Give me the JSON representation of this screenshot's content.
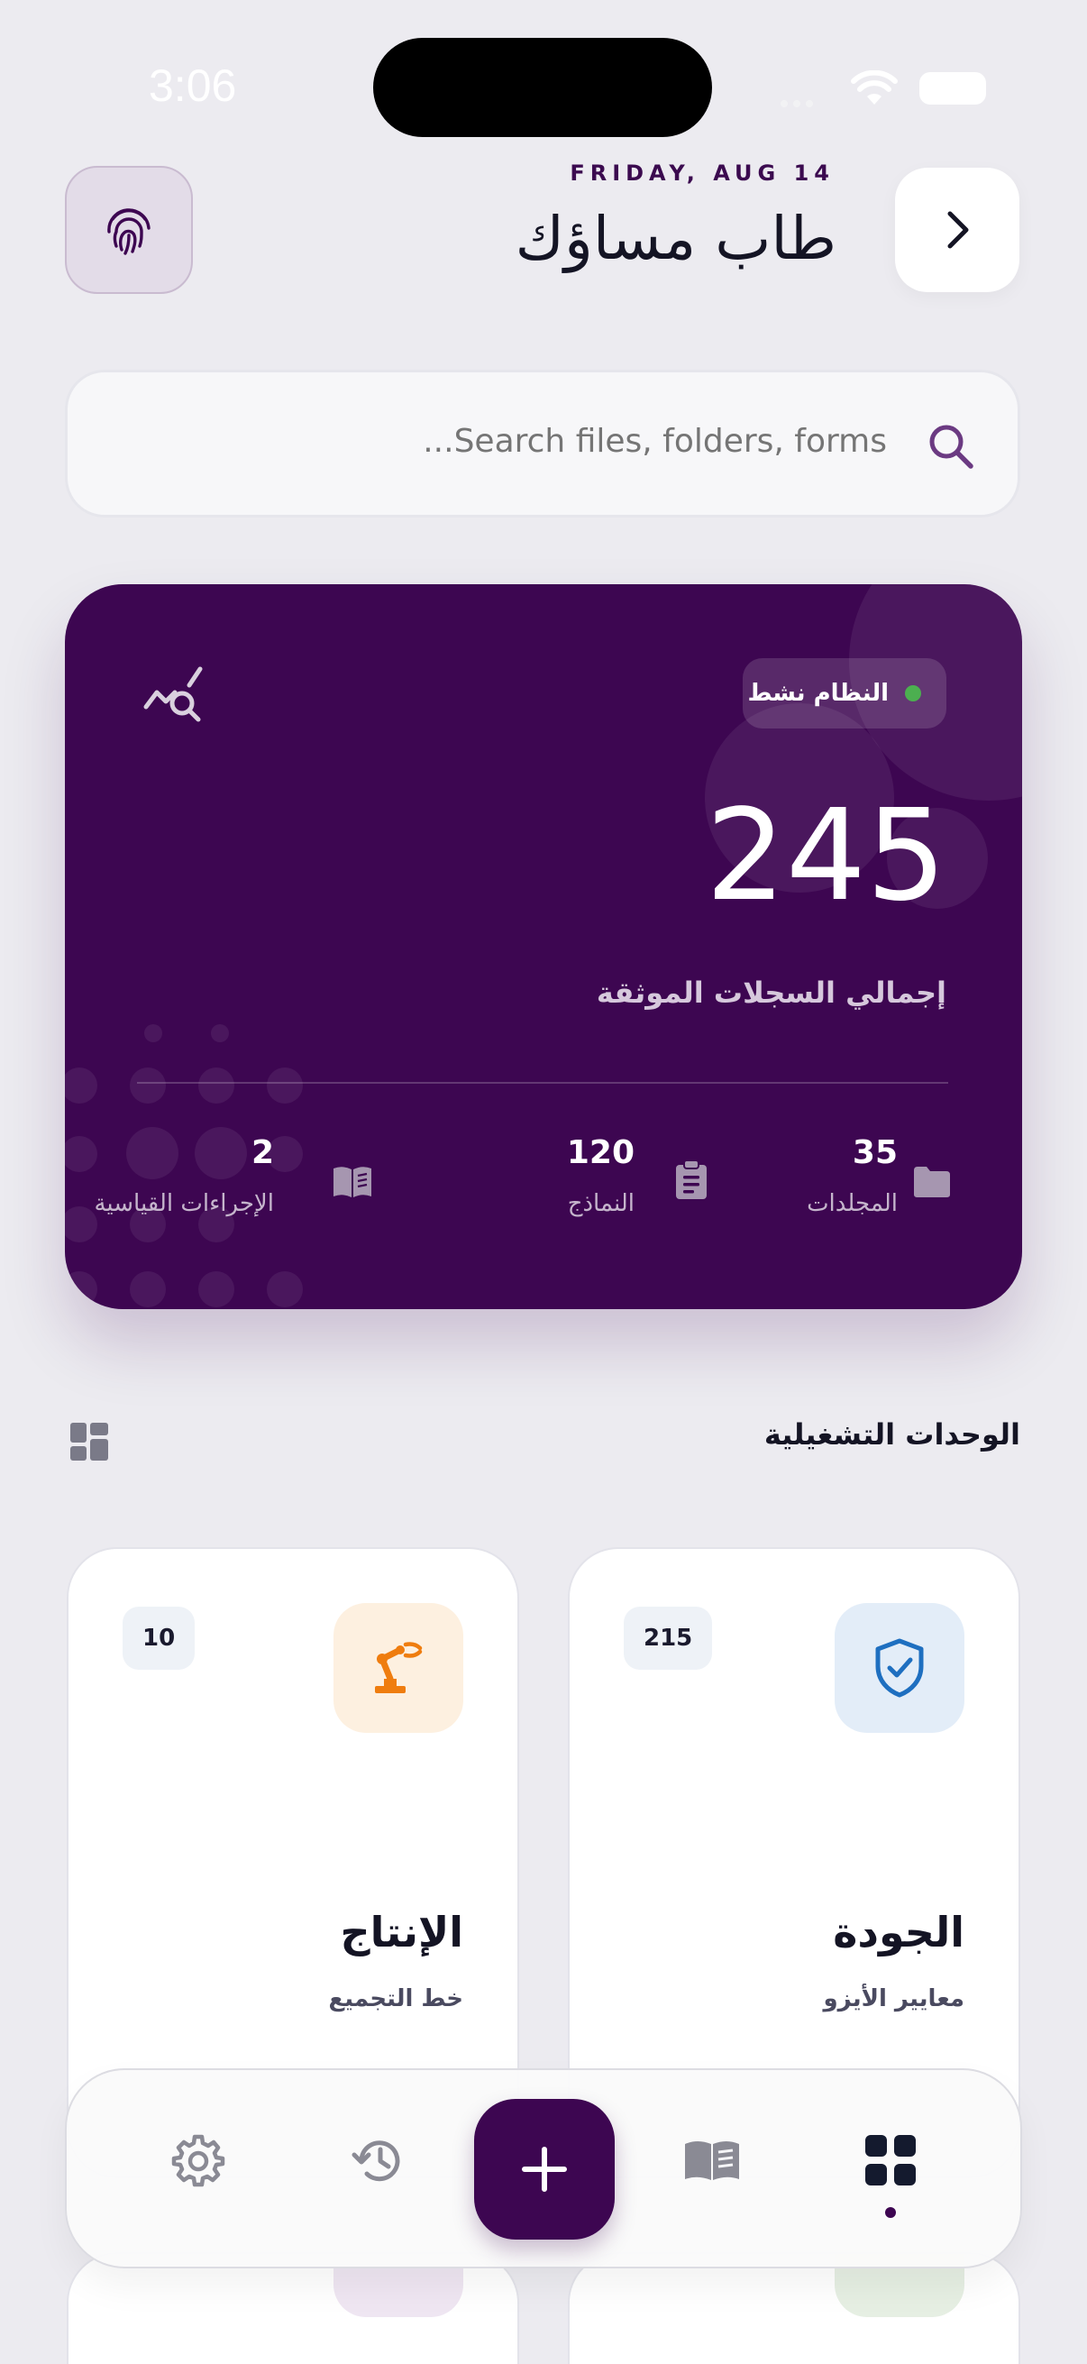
{
  "status_bar": {
    "time": "3:06"
  },
  "header": {
    "date": "FRIDAY, AUG 14",
    "title": "طاب مساؤك"
  },
  "search": {
    "placeholder": "...Search files, folders, forms"
  },
  "hero": {
    "status_chip": "النظام نشط",
    "total": "245",
    "total_label": "إجمالي السجلات الموثقة",
    "stats": [
      {
        "value": "35",
        "label": "المجلدات",
        "icon": "folder-icon"
      },
      {
        "value": "120",
        "label": "النماذج",
        "icon": "clipboard-icon"
      },
      {
        "value": "2",
        "label": "الإجراءات القياسية",
        "icon": "book-icon"
      }
    ]
  },
  "section": {
    "title": "الوحدات التشغيلية"
  },
  "modules": [
    {
      "title": "الجودة",
      "subtitle": "معايير الأيزو",
      "count": "215",
      "icon": "shield-check-icon",
      "tint": "#e3edf8",
      "icon_color": "#1e6fc0"
    },
    {
      "title": "الإنتاج",
      "subtitle": "خط التجميع",
      "count": "10",
      "icon": "robot-arm-icon",
      "tint": "#fdf0e0",
      "icon_color": "#ef7d0f"
    }
  ],
  "bottom_nav": {
    "items": [
      "grid-icon",
      "book-icon",
      "add-icon",
      "history-icon",
      "settings-icon"
    ],
    "active": "grid-icon"
  },
  "colors": {
    "brand": "#3d0651",
    "active_status": "#4caf50"
  }
}
